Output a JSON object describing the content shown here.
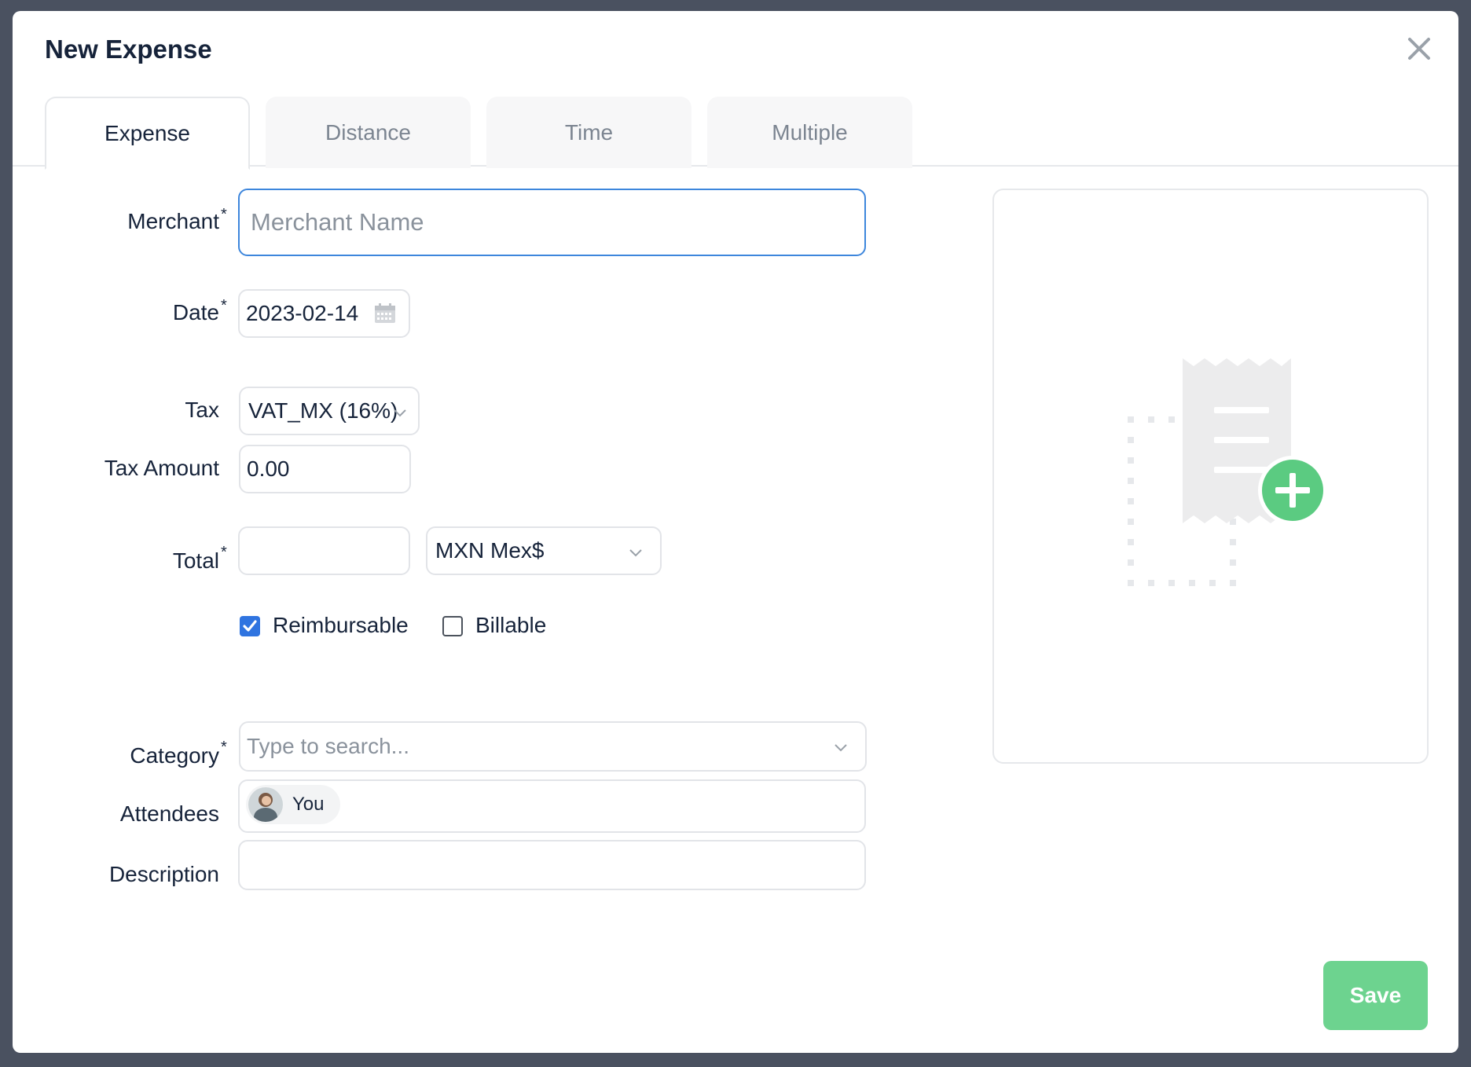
{
  "modal": {
    "title": "New Expense",
    "close_icon": "close-icon"
  },
  "tabs": [
    {
      "label": "Expense",
      "active": true
    },
    {
      "label": "Distance",
      "active": false
    },
    {
      "label": "Time",
      "active": false
    },
    {
      "label": "Multiple",
      "active": false
    }
  ],
  "form": {
    "merchant": {
      "label": "Merchant",
      "required_mark": "*",
      "placeholder": "Merchant Name",
      "value": ""
    },
    "date": {
      "label": "Date",
      "required_mark": "*",
      "value": "2023-02-14",
      "icon": "calendar-icon"
    },
    "tax": {
      "label": "Tax",
      "value": "VAT_MX (16%)"
    },
    "tax_amount": {
      "label": "Tax Amount",
      "value": "0.00"
    },
    "total": {
      "label": "Total",
      "required_mark": "*",
      "value": "",
      "currency": "MXN Mex$"
    },
    "reimbursable": {
      "label": "Reimbursable",
      "checked": true
    },
    "billable": {
      "label": "Billable",
      "checked": false
    },
    "category": {
      "label": "Category",
      "required_mark": "*",
      "placeholder": "Type to search..."
    },
    "attendees": {
      "label": "Attendees",
      "chips": [
        {
          "name": "You"
        }
      ]
    },
    "description": {
      "label": "Description",
      "value": ""
    }
  },
  "receipt_upload": {
    "icon": "receipt-add-icon"
  },
  "footer": {
    "save_label": "Save"
  },
  "colors": {
    "accent_blue": "#2f74e0",
    "save_green": "#6dd38f",
    "upload_green": "#5bcb81",
    "text_dark": "#16233a"
  }
}
